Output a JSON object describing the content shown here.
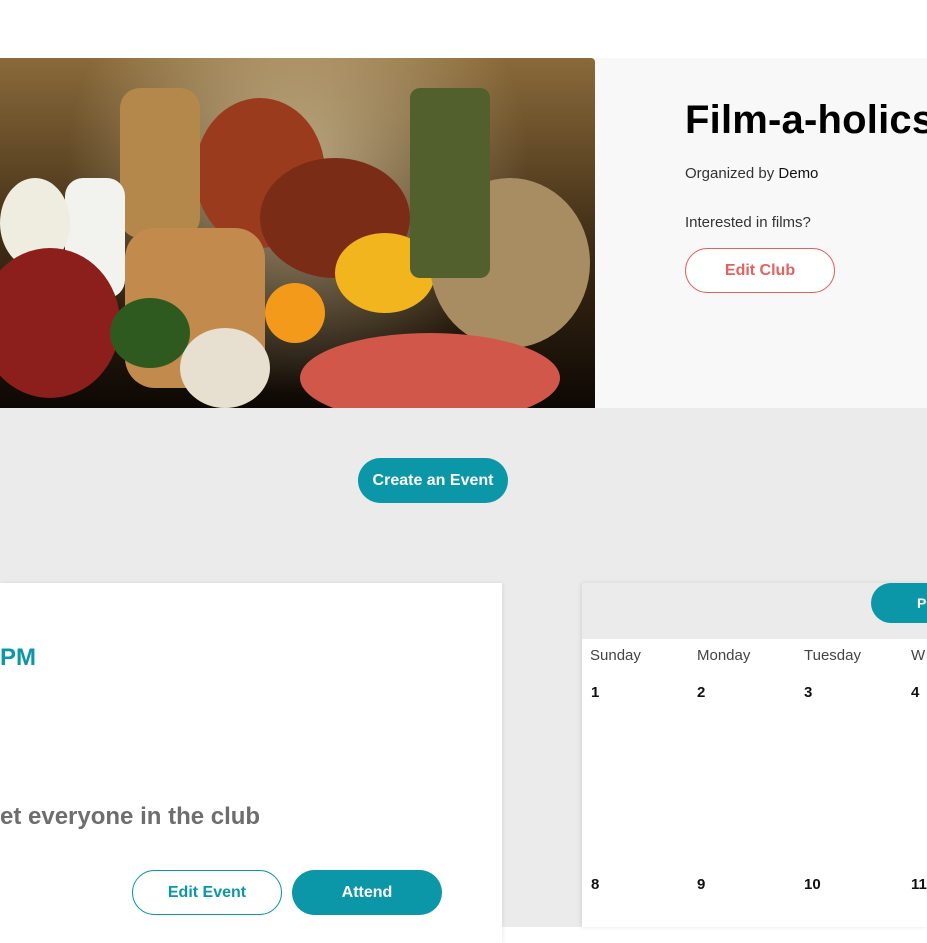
{
  "club": {
    "title": "Film-a-holics",
    "organized_prefix": "Organized by",
    "organizer": "Demo",
    "description": "Interested in films?",
    "edit_label": "Edit Club"
  },
  "actions": {
    "create_event_label": "Create an Event"
  },
  "event": {
    "time_text": "PM",
    "description_text": "et everyone in the club",
    "edit_label": "Edit Event",
    "attend_label": "Attend"
  },
  "calendar": {
    "nav_button_label": "P",
    "day_names": [
      "Sunday",
      "Monday",
      "Tuesday",
      "W"
    ],
    "week1": [
      "1",
      "2",
      "3",
      "4"
    ],
    "week2": [
      "8",
      "9",
      "10",
      "11"
    ]
  },
  "colors": {
    "accent": "#0b97a8",
    "edit_club": "#e5615f",
    "section_bg": "#ebebeb"
  }
}
